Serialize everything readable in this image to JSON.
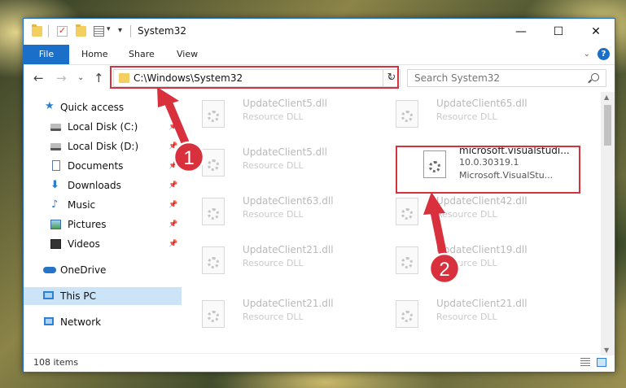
{
  "window": {
    "title": "System32",
    "minimize": "—",
    "maximize": "☐",
    "close": "✕"
  },
  "ribbon": {
    "file": "File",
    "home": "Home",
    "share": "Share",
    "view": "View",
    "expand": "⌄",
    "help": "?"
  },
  "address": {
    "path": "C:\\Windows\\System32",
    "dropdown": "⌄",
    "refresh": "↻"
  },
  "search": {
    "placeholder": "Search System32"
  },
  "nav": {
    "back": "←",
    "forward": "→",
    "recent": "⌄",
    "up": "↑",
    "items": [
      {
        "label": "Quick access",
        "icon": "star-icon"
      },
      {
        "label": "Local Disk (C:)",
        "icon": "drive-icon",
        "pin": "📌"
      },
      {
        "label": "Local Disk (D:)",
        "icon": "drive-icon",
        "pin": "📌"
      },
      {
        "label": "Documents",
        "icon": "document-icon",
        "pin": "📌"
      },
      {
        "label": "Downloads",
        "icon": "download-icon",
        "pin": "📌"
      },
      {
        "label": "Music",
        "icon": "music-icon",
        "pin": "📌"
      },
      {
        "label": "Pictures",
        "icon": "pictures-icon",
        "pin": "📌"
      },
      {
        "label": "Videos",
        "icon": "video-icon",
        "pin": "📌"
      },
      {
        "label": "OneDrive",
        "icon": "cloud-icon"
      },
      {
        "label": "This PC",
        "icon": "computer-icon"
      },
      {
        "label": "Network",
        "icon": "network-icon"
      }
    ]
  },
  "files": [
    {
      "name": "UpdateClient5.dll",
      "type": "Resource DLL"
    },
    {
      "name": "UpdateClient65.dll",
      "type": "Resource DLL"
    },
    {
      "name": "UpdateClient5.dll",
      "type": "Resource DLL"
    },
    {
      "name": "microsoft.visualstudi...",
      "type": "10.0.30319.1",
      "desc": "Microsoft.VisualStu..."
    },
    {
      "name": "UpdateClient63.dll",
      "type": "Resource DLL"
    },
    {
      "name": "UpdateClient42.dll",
      "type": "Resource DLL"
    },
    {
      "name": "UpdateClient21.dll",
      "type": "Resource DLL"
    },
    {
      "name": "UpdateClient19.dll",
      "type": "Resource DLL"
    },
    {
      "name": "UpdateClient21.dll",
      "type": "Resource DLL"
    },
    {
      "name": "UpdateClient21.dll",
      "type": "Resource DLL"
    }
  ],
  "status": {
    "count": "108 items"
  },
  "annotations": {
    "step1": "1",
    "step2": "2",
    "color": "#d8303d"
  }
}
